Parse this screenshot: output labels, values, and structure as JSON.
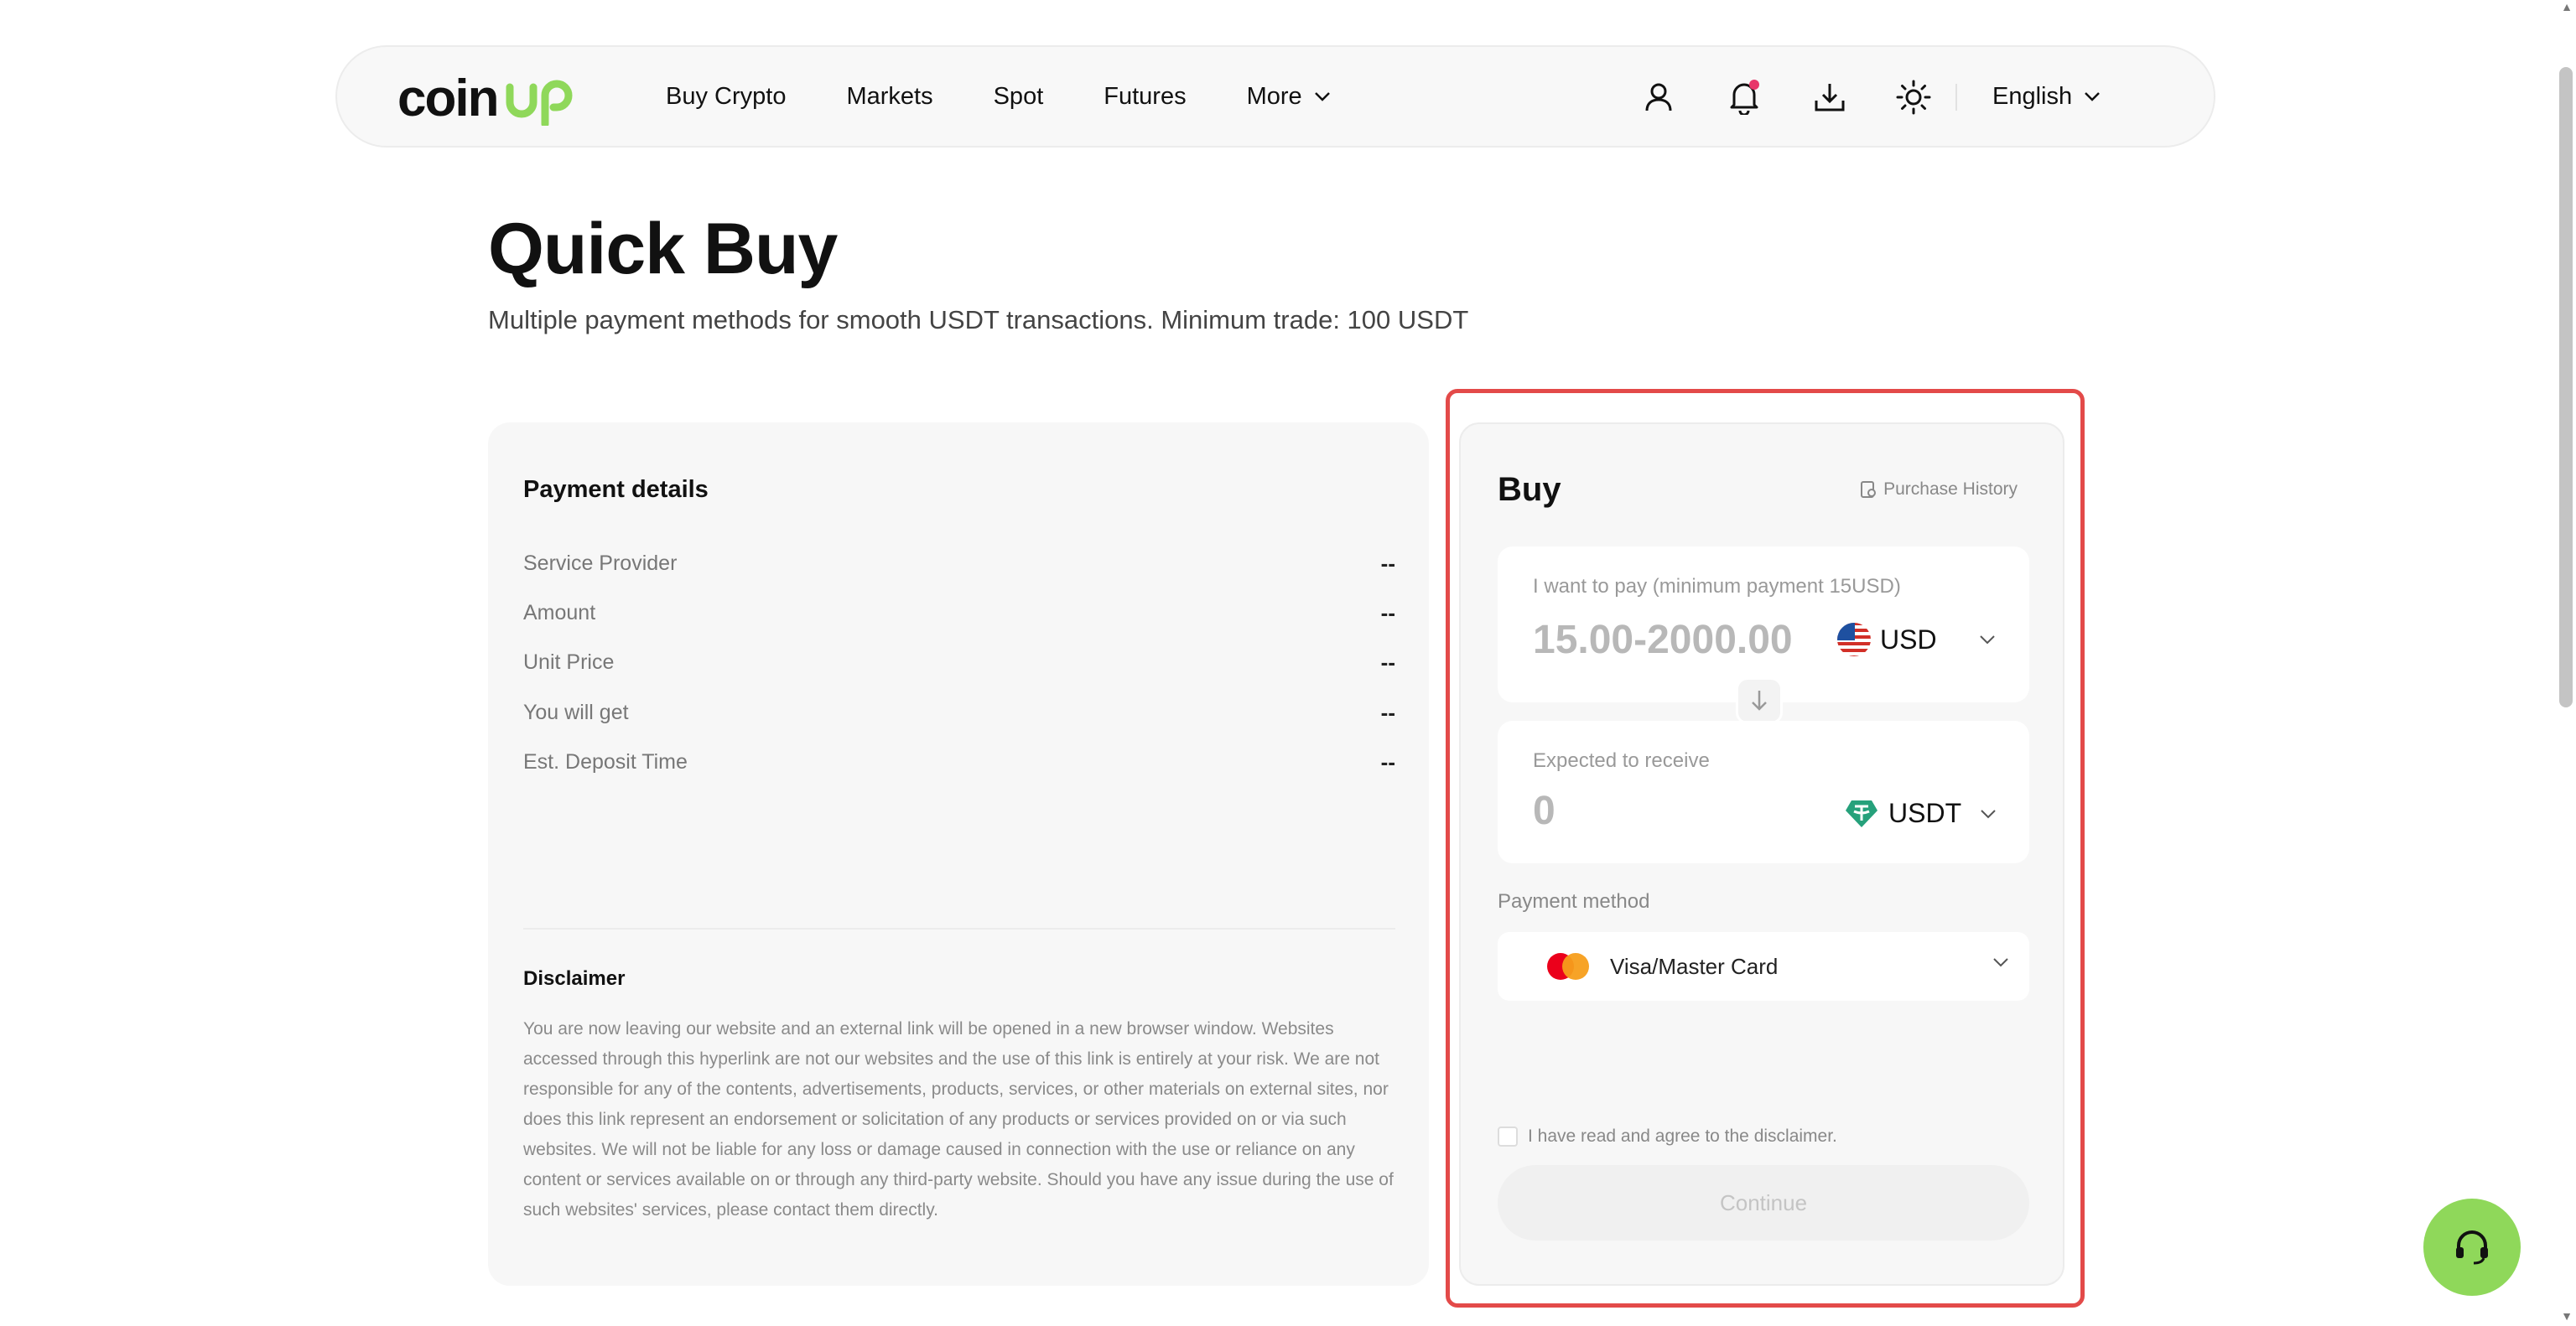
{
  "brand": {
    "name": "coinup"
  },
  "nav": {
    "items": [
      {
        "label": "Buy Crypto"
      },
      {
        "label": "Markets"
      },
      {
        "label": "Spot"
      },
      {
        "label": "Futures"
      },
      {
        "label": "More"
      }
    ],
    "language": "English",
    "icons": [
      "user-icon",
      "bell-icon",
      "download-icon",
      "sun-icon"
    ],
    "notification_dot_color": "#e8366a"
  },
  "page": {
    "title": "Quick Buy",
    "subtitle": "Multiple payment methods for smooth USDT transactions. Minimum trade: 100 USDT"
  },
  "payment_details": {
    "title": "Payment details",
    "rows": [
      {
        "label": "Service Provider",
        "value": "--"
      },
      {
        "label": "Amount",
        "value": "--"
      },
      {
        "label": "Unit Price",
        "value": "--"
      },
      {
        "label": "You will get",
        "value": "--"
      },
      {
        "label": "Est. Deposit Time",
        "value": "--"
      }
    ],
    "disclaimer_title": "Disclaimer",
    "disclaimer_text": "You are now leaving our website and an external link will be opened in a new browser window. Websites accessed through this hyperlink are not our websites and the use of this link is entirely at your risk. We are not responsible for any of the contents, advertisements, products, services, or other materials on external sites, nor does this link represent an endorsement or solicitation of any products or services provided on or via such websites. We will not be liable for any loss or damage caused in connection with the use or reliance on any content or services available on or through any third-party website. Should you have any issue during the use of such websites' services, please contact them directly."
  },
  "buy": {
    "title": "Buy",
    "purchase_history": "Purchase History",
    "pay_label": "I want to pay (minimum payment 15USD)",
    "pay_placeholder": "15.00-2000.00",
    "pay_currency": "USD",
    "receive_label": "Expected to receive",
    "receive_value": "0",
    "receive_currency": "USDT",
    "payment_method_label": "Payment method",
    "payment_method": "Visa/Master Card",
    "agree_text": "I have read and agree to the disclaimer.",
    "continue_label": "Continue",
    "highlight_color": "#e34a49",
    "accent_color": "#8fd85a"
  }
}
